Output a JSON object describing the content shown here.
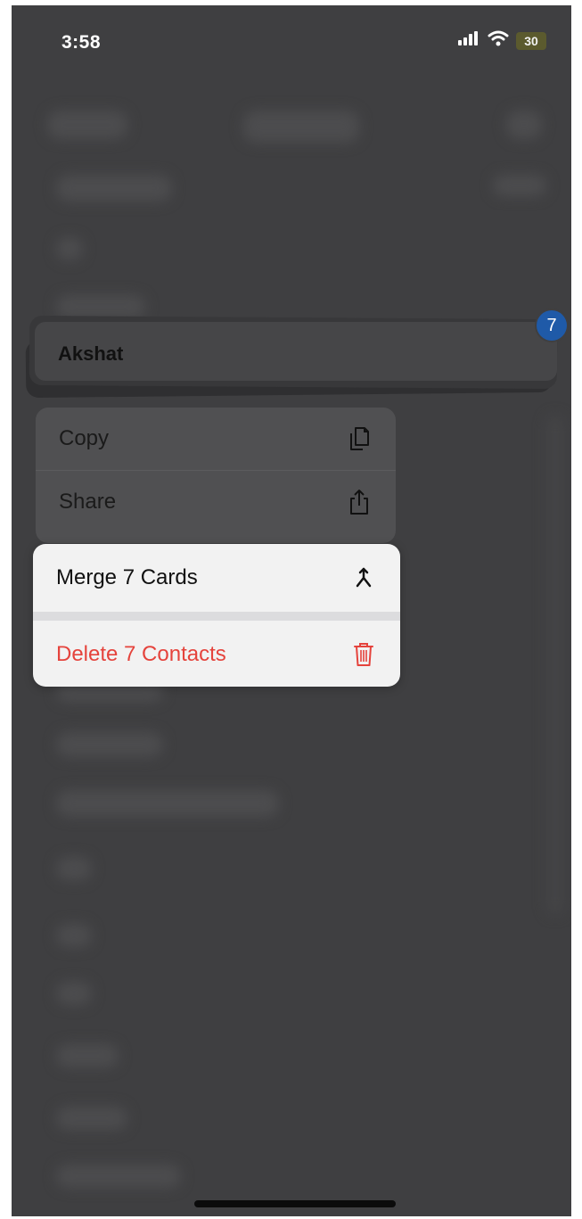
{
  "status_bar": {
    "time": "3:58",
    "battery_level": "30",
    "icons": [
      "signal-icon",
      "wifi-icon",
      "battery-icon"
    ]
  },
  "contact_stack": {
    "name": "Akshat",
    "selected_count": "7"
  },
  "context_menu": {
    "items": [
      {
        "label": "Copy",
        "icon": "copy-icon"
      },
      {
        "label": "Share",
        "icon": "share-icon"
      }
    ],
    "merge": {
      "label": "Merge 7 Cards",
      "icon": "merge-icon"
    },
    "delete": {
      "label": "Delete 7 Contacts",
      "icon": "trash-icon",
      "color": "#e5433c"
    }
  },
  "colors": {
    "background_dimmed": "#3f3f41",
    "badge": "#1f5aa8",
    "destructive": "#e5433c"
  }
}
